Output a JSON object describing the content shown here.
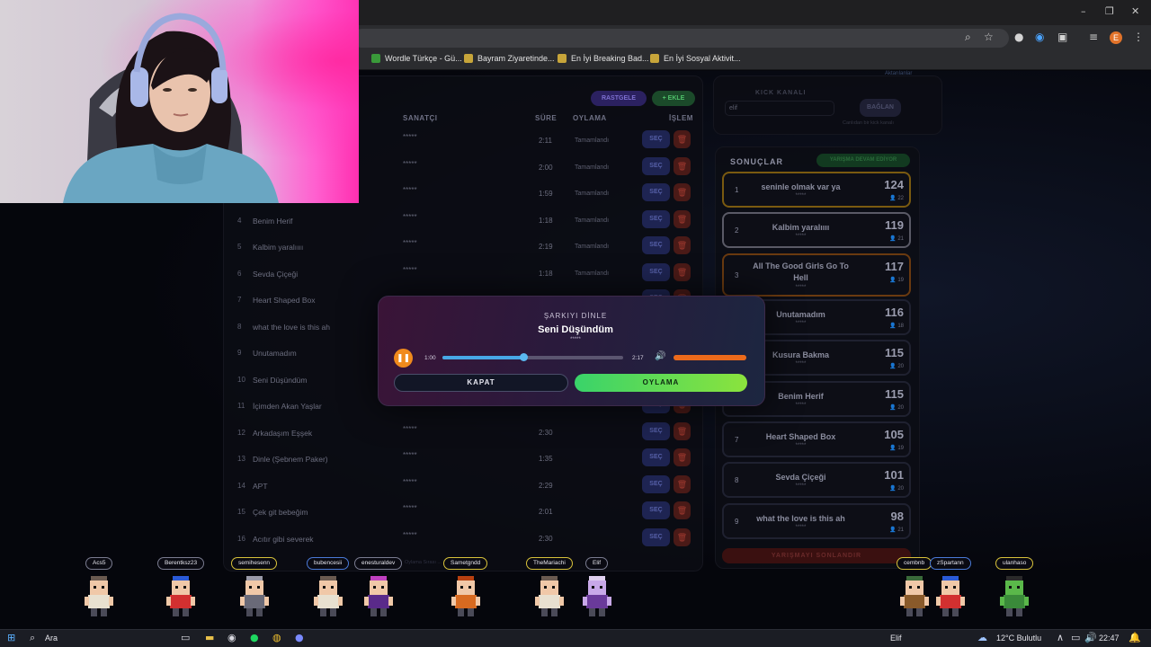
{
  "browser": {
    "window_controls": [
      "–",
      "❐",
      "✕"
    ],
    "bookmarks": [
      {
        "label": "Wordle Türkçe - Gü...",
        "color": "#3a9a3a"
      },
      {
        "label": "Bayram Ziyaretinde...",
        "color": "#c7a53a"
      },
      {
        "label": "En İyi Breaking Bad...",
        "color": "#c7a53a"
      },
      {
        "label": "En İyi Sosyal Aktivit...",
        "color": "#c7a53a"
      }
    ],
    "profile_initial": "E"
  },
  "top_buttons": {
    "shuffle": "RASTGELE",
    "add": "+ EKLE"
  },
  "table": {
    "headers": {
      "artist": "SANATÇI",
      "duration": "SÜRE",
      "voting": "OYLAMA",
      "action": "İŞLEM"
    },
    "select_label": "SEÇ",
    "rows": [
      {
        "num": "",
        "name": "",
        "artist": "*****",
        "duration": "2:11",
        "status": "Tamamlandı"
      },
      {
        "num": "",
        "name": "",
        "artist": "*****",
        "duration": "2:00",
        "status": "Tamamlandı"
      },
      {
        "num": "",
        "name": "",
        "artist": "*****",
        "duration": "1:59",
        "status": "Tamamlandı"
      },
      {
        "num": "4",
        "name": "Benim Herif",
        "artist": "*****",
        "duration": "1:18",
        "status": "Tamamlandı"
      },
      {
        "num": "5",
        "name": "Kalbim yaralıııı",
        "artist": "*****",
        "duration": "2:19",
        "status": "Tamamlandı"
      },
      {
        "num": "6",
        "name": "Sevda Çiçeği",
        "artist": "*****",
        "duration": "1:18",
        "status": "Tamamlandı"
      },
      {
        "num": "7",
        "name": "Heart Shaped Box",
        "artist": "",
        "duration": "",
        "status": ""
      },
      {
        "num": "8",
        "name": "what the love is this ah",
        "artist": "",
        "duration": "",
        "status": ""
      },
      {
        "num": "9",
        "name": "Unutamadım",
        "artist": "",
        "duration": "",
        "status": ""
      },
      {
        "num": "10",
        "name": "Seni Düşündüm",
        "artist": "",
        "duration": "",
        "status": ""
      },
      {
        "num": "11",
        "name": "İçimden Akan Yaşlar",
        "artist": "",
        "duration": "",
        "status": ""
      },
      {
        "num": "12",
        "name": "Arkadaşım Eşşek",
        "artist": "*****",
        "duration": "2:30",
        "status": ""
      },
      {
        "num": "13",
        "name": "Dinle (Şebnem Paker)",
        "artist": "*****",
        "duration": "1:35",
        "status": ""
      },
      {
        "num": "14",
        "name": "APT",
        "artist": "*****",
        "duration": "2:29",
        "status": ""
      },
      {
        "num": "15",
        "name": "Çek git bebeğim",
        "artist": "*****",
        "duration": "2:01",
        "status": ""
      },
      {
        "num": "16",
        "name": "Acıtır gibi severek",
        "artist": "*****",
        "duration": "2:30",
        "status": ""
      }
    ]
  },
  "right_top": {
    "channel_label": "KICK KANALI",
    "channel_value": "elif",
    "connect_label": "BAĞLAN",
    "hint": "Canlıdan bir kick kanalı",
    "link": "Aktarılanlar"
  },
  "results": {
    "title": "SONUÇLAR",
    "badge": "YARIŞMA DEVAM EDİYOR",
    "end_button": "YARIŞMAYI SONLANDIR",
    "items": [
      {
        "rank": "1",
        "name": "seninle olmak var ya",
        "stars": "*****",
        "score": "124",
        "voters": "22",
        "tier": "gold"
      },
      {
        "rank": "2",
        "name": "Kalbim yaralıııı",
        "stars": "*****",
        "score": "119",
        "voters": "21",
        "tier": "silver"
      },
      {
        "rank": "3",
        "name": "All The Good Girls Go To Hell",
        "stars": "*****",
        "score": "117",
        "voters": "19",
        "tier": "bronze"
      },
      {
        "rank": "",
        "name": "Unutamadım",
        "stars": "*****",
        "score": "116",
        "voters": "18",
        "tier": ""
      },
      {
        "rank": "",
        "name": "Kusura Bakma",
        "stars": "*****",
        "score": "115",
        "voters": "20",
        "tier": ""
      },
      {
        "rank": "",
        "name": "Benim Herif",
        "stars": "*****",
        "score": "115",
        "voters": "20",
        "tier": ""
      },
      {
        "rank": "7",
        "name": "Heart Shaped Box",
        "stars": "*****",
        "score": "105",
        "voters": "19",
        "tier": ""
      },
      {
        "rank": "8",
        "name": "Sevda Çiçeği",
        "stars": "*****",
        "score": "101",
        "voters": "20",
        "tier": ""
      },
      {
        "rank": "9",
        "name": "what the love is this ah",
        "stars": "*****",
        "score": "98",
        "voters": "21",
        "tier": ""
      }
    ]
  },
  "modal": {
    "title": "ŞARKIYI DİNLE",
    "song": "Seni Düşündüm",
    "stars": "*****",
    "current_time": "1:00",
    "total_time": "2:17",
    "progress": 0.45,
    "volume": 1.0,
    "close_label": "KAPAT",
    "vote_label": "OYLAMA"
  },
  "viewers": [
    {
      "name": "Acs5",
      "style": ""
    },
    {
      "name": "Berentksz23",
      "style": ""
    },
    {
      "name": "semihesenn",
      "style": "yl"
    },
    {
      "name": "bubencesii",
      "style": "bl"
    },
    {
      "name": "enesturaldev",
      "style": ""
    },
    {
      "name": "Sametgndd",
      "style": "yl"
    },
    {
      "name": "TheMariachi",
      "style": "yl"
    },
    {
      "name": "Elif",
      "style": ""
    },
    {
      "name": "cembnb",
      "style": "yl"
    },
    {
      "name": "zSpartann",
      "style": "bl"
    },
    {
      "name": "ulanhaso",
      "style": "yl"
    }
  ],
  "footer_hint": "Oylama Sırası ... Yayından hazır",
  "taskbar": {
    "search": "Ara",
    "user": "Elif",
    "weather": "12°C  Bulutlu",
    "time": "22:47"
  }
}
